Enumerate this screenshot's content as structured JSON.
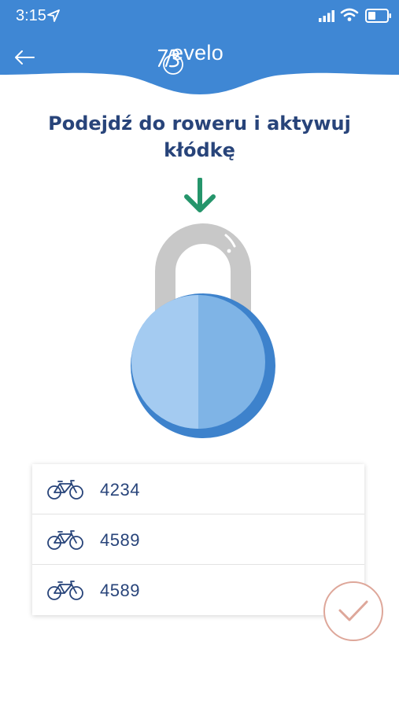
{
  "status_bar": {
    "time": "3:15"
  },
  "header": {
    "logo_text": "evelo",
    "back_icon": "arrow-left-icon"
  },
  "page": {
    "title": "Podejdź do roweru i aktywuj kłódkę"
  },
  "bikes": [
    {
      "id": "4234",
      "icon": "bicycle-icon"
    },
    {
      "id": "4589",
      "icon": "bicycle-icon"
    },
    {
      "id": "4589",
      "icon": "bicycle-icon"
    }
  ],
  "confirm": {
    "icon": "checkmark-icon"
  },
  "colors": {
    "primary_blue": "#3f87d4",
    "title_navy": "#28447a",
    "arrow_green": "#25956b",
    "lock_shackle": "#c8c8c8",
    "lock_body": "#7fb4e6",
    "confirm_accent": "#dea79a"
  }
}
